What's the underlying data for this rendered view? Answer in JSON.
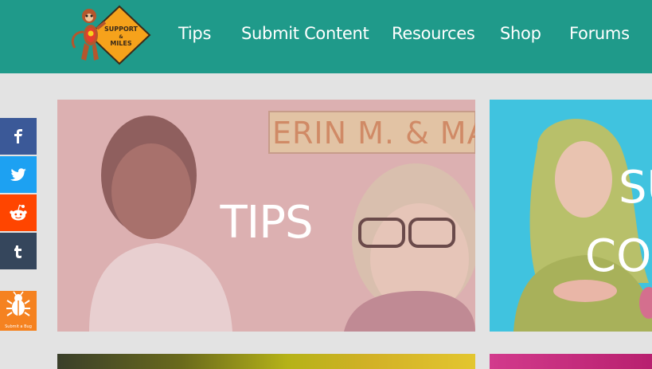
{
  "header": {
    "logo_text": "SUPPORT & MILES",
    "nav": [
      {
        "label": "Tips"
      },
      {
        "label": "Submit Content"
      },
      {
        "label": "Resources"
      },
      {
        "label": "Shop"
      },
      {
        "label": "Forums"
      }
    ]
  },
  "share": {
    "facebook_icon": "facebook-icon",
    "twitter_icon": "twitter-icon",
    "reddit_icon": "reddit-icon",
    "tumblr_icon": "tumblr-icon"
  },
  "bug": {
    "label": "Submit a Bug"
  },
  "cards": {
    "tips": {
      "title": "TIPS",
      "sign_text": "ERIN M. & MAD"
    },
    "submit": {
      "title_line1": "SU",
      "title_line2": "CO"
    }
  },
  "colors": {
    "header_bg": "#1f9a8a",
    "page_bg": "#e3e3e3",
    "tips_overlay": "#d8a7a9",
    "submit_overlay": "#3bc0de"
  }
}
